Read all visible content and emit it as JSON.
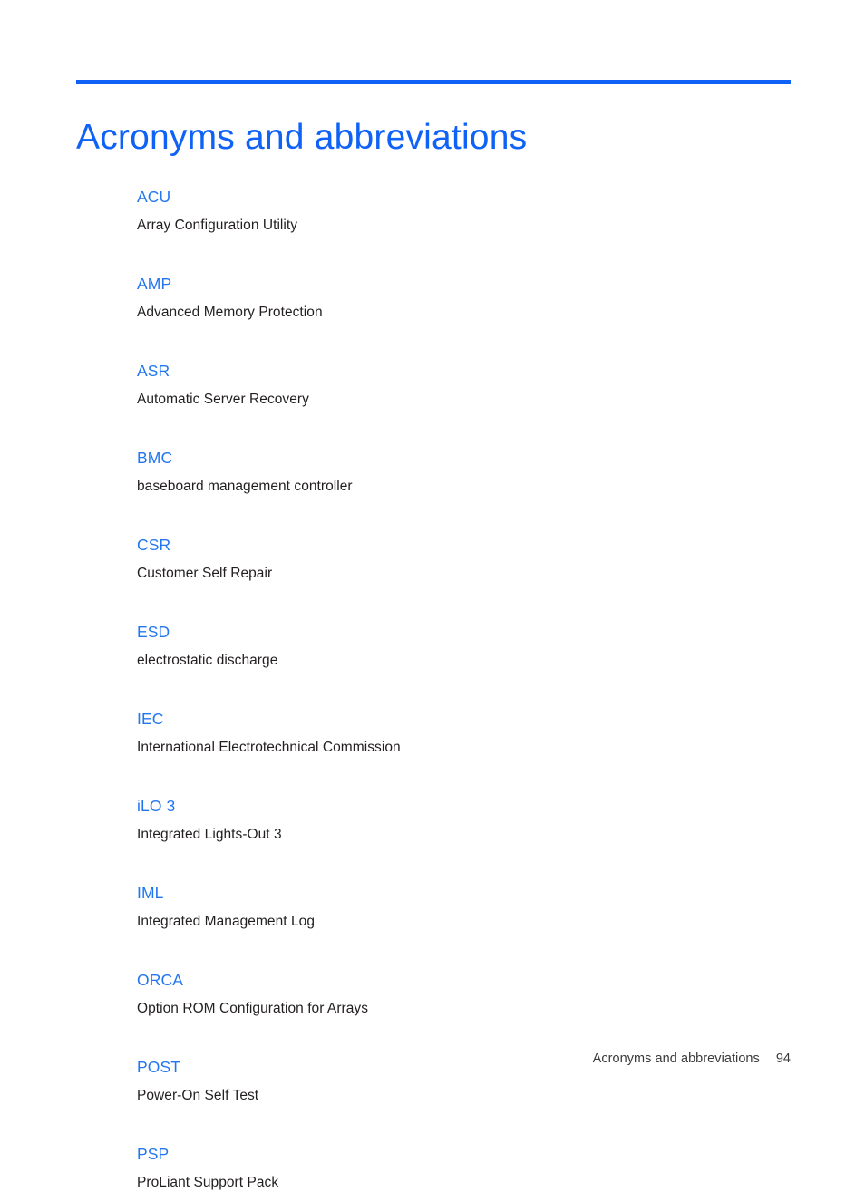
{
  "document": {
    "title": "Acronyms and abbreviations",
    "accent_color": "#0f62f5",
    "term_color": "#2276f0",
    "body_color": "#231f20"
  },
  "glossary": {
    "entries": [
      {
        "term": "ACU",
        "definition": "Array Configuration Utility"
      },
      {
        "term": "AMP",
        "definition": "Advanced Memory Protection"
      },
      {
        "term": "ASR",
        "definition": "Automatic Server Recovery"
      },
      {
        "term": "BMC",
        "definition": "baseboard management controller"
      },
      {
        "term": "CSR",
        "definition": "Customer Self Repair"
      },
      {
        "term": "ESD",
        "definition": "electrostatic discharge"
      },
      {
        "term": "IEC",
        "definition": "International Electrotechnical Commission"
      },
      {
        "term": "iLO 3",
        "definition": "Integrated Lights-Out 3"
      },
      {
        "term": "IML",
        "definition": "Integrated Management Log"
      },
      {
        "term": "ORCA",
        "definition": "Option ROM Configuration for Arrays"
      },
      {
        "term": "POST",
        "definition": "Power-On Self Test"
      },
      {
        "term": "PSP",
        "definition": "ProLiant Support Pack"
      }
    ]
  },
  "footer": {
    "label": "Acronyms and abbreviations",
    "page_number": "94"
  }
}
